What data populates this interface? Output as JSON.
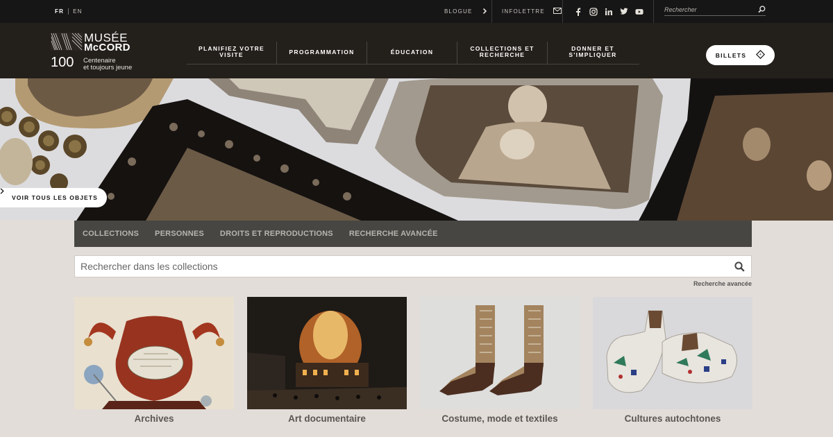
{
  "topbar": {
    "lang_active": "FR",
    "lang_other": "EN",
    "blog_label": "BLOGUE",
    "newsletter_label": "INFOLETTRE",
    "search_placeholder": "Rechercher",
    "social_icons": [
      "facebook-icon",
      "instagram-icon",
      "linkedin-icon",
      "twitter-icon",
      "youtube-icon"
    ]
  },
  "logo": {
    "line1": "MUSÉE",
    "line2": "McCORD",
    "number": "100",
    "tagline1": "Centenaire",
    "tagline2": "et toujours jeune"
  },
  "mainnav": {
    "items": [
      {
        "line1": "PLANIFIEZ VOTRE",
        "line2": "VISITE"
      },
      {
        "line1": "PROGRAMMATION",
        "line2": ""
      },
      {
        "line1": "ÉDUCATION",
        "line2": ""
      },
      {
        "line1": "COLLECTIONS ET",
        "line2": "RECHERCHE"
      },
      {
        "line1": "DONNER ET",
        "line2": "S'IMPLIQUER"
      }
    ],
    "tickets_label": "BILLETS"
  },
  "hero": {
    "view_all_label": "VOIR TOUS LES OBJETS"
  },
  "subnav": {
    "items": [
      "COLLECTIONS",
      "PERSONNES",
      "DROITS ET REPRODUCTIONS",
      "RECHERCHE AVANCÉE"
    ]
  },
  "collection_search": {
    "placeholder": "Rechercher dans les collections",
    "advanced_link": "Recherche avancée"
  },
  "cards": [
    {
      "label": "Archives"
    },
    {
      "label": "Art documentaire"
    },
    {
      "label": "Costume, mode et textiles"
    },
    {
      "label": "Cultures autochtones"
    }
  ],
  "colors": {
    "topbar_bg": "#161616",
    "header_bg": "#231f1b",
    "page_bg": "#e2ddd8",
    "subnav_bg": "#474642"
  }
}
